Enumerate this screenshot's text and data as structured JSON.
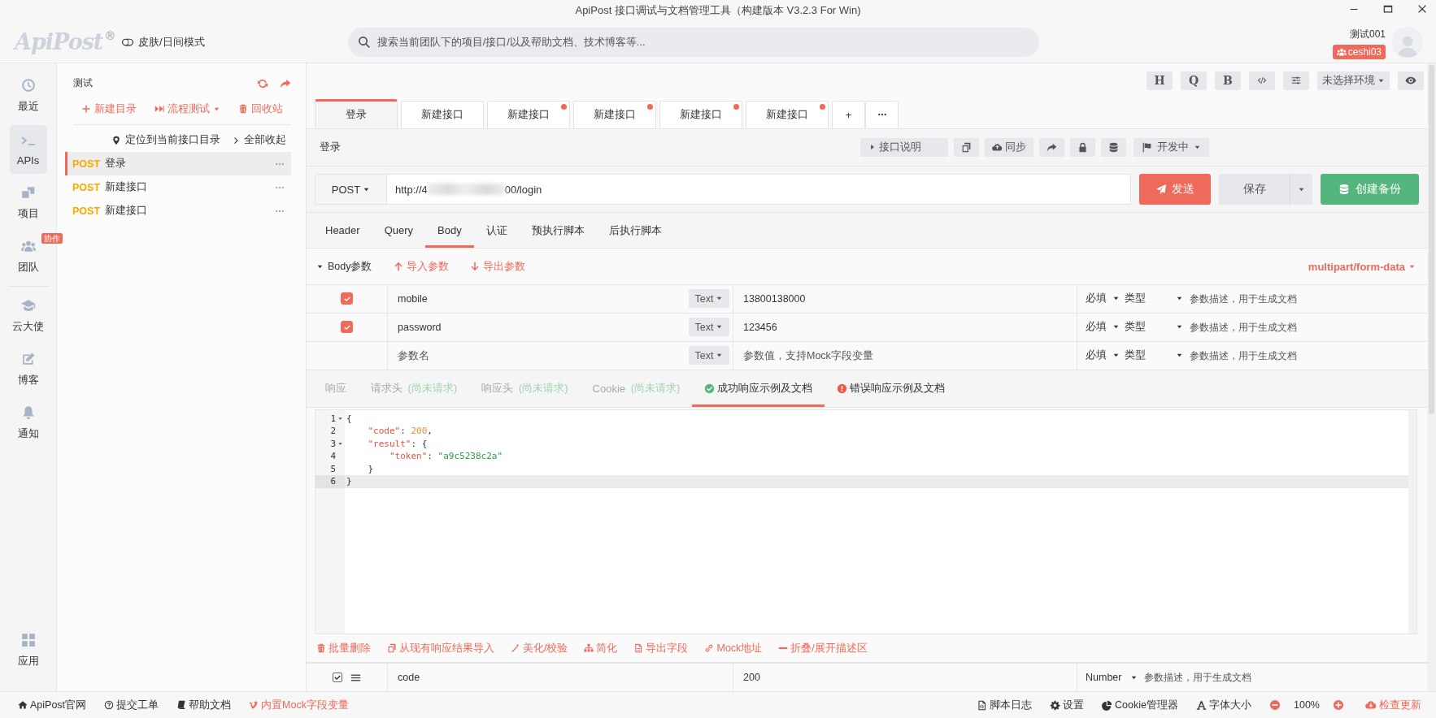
{
  "window": {
    "title": "ApiPost 接口调试与文档管理工具（构建版本 V3.2.3 For Win)"
  },
  "header": {
    "logo": "ApiPost",
    "logo_mark": "®",
    "theme_toggle": "皮肤/日间模式",
    "search": {
      "placeholder": "搜索当前团队下的项目/接口/以及帮助文档、技术博客等..."
    },
    "user_name": "测试001",
    "team": "ceshi03"
  },
  "nav": {
    "items": [
      {
        "label": "最近",
        "selected": false
      },
      {
        "label": "APIs",
        "selected": true
      },
      {
        "label": "项目",
        "selected": false
      },
      {
        "label": "团队",
        "selected": false,
        "badge": "协作"
      },
      {
        "label": "云大使",
        "selected": false
      },
      {
        "label": "博客",
        "selected": false
      },
      {
        "label": "通知",
        "selected": false
      }
    ],
    "bottom": {
      "label": "应用",
      "selected": false
    }
  },
  "tree": {
    "title": "测试",
    "actions": [
      "新建目录",
      "流程测试",
      "回收站"
    ],
    "locate": "定位到当前接口目录",
    "collapse": "全部收起",
    "items": [
      {
        "method": "POST",
        "name": "登录",
        "selected": true
      },
      {
        "method": "POST",
        "name": "新建接口",
        "selected": false
      },
      {
        "method": "POST",
        "name": "新建接口",
        "selected": false
      }
    ]
  },
  "toolbar": {
    "letters": [
      "H",
      "Q",
      "B"
    ],
    "environment": "未选择环境"
  },
  "tabs": [
    {
      "label": "登录",
      "selected": true,
      "modified": false
    },
    {
      "label": "新建接口",
      "selected": false,
      "modified": false
    },
    {
      "label": "新建接口",
      "selected": false,
      "modified": true
    },
    {
      "label": "新建接口",
      "selected": false,
      "modified": true
    },
    {
      "label": "新建接口",
      "selected": false,
      "modified": true
    },
    {
      "label": "新建接口",
      "selected": false,
      "modified": true
    }
  ],
  "new_tab": "+",
  "api": {
    "name": "登录",
    "doc_button": "接口说明",
    "sync_button": "同步",
    "status": "开发中"
  },
  "request": {
    "method": "POST",
    "url_start": "http://4",
    "url_end": "00/login",
    "send": "发送",
    "save": "保存",
    "backup": "创建备份"
  },
  "request_tabs": [
    {
      "label": "Header",
      "selected": false
    },
    {
      "label": "Query",
      "selected": false
    },
    {
      "label": "Body",
      "selected": true
    },
    {
      "label": "认证",
      "selected": false
    },
    {
      "label": "预执行脚本",
      "selected": false
    },
    {
      "label": "后执行脚本",
      "selected": false
    }
  ],
  "body": {
    "title": "Body参数",
    "import": "导入参数",
    "export": "导出参数",
    "content_type": "multipart/form-data",
    "params": [
      {
        "checked": true,
        "key": "mobile",
        "type": "Text",
        "value": "13800138000",
        "required": "必填",
        "data_type": "类型",
        "description_placeholder": "参数描述，用于生成文档"
      },
      {
        "checked": true,
        "key": "password",
        "type": "Text",
        "value": "123456",
        "required": "必填",
        "data_type": "类型",
        "description_placeholder": "参数描述，用于生成文档"
      },
      {
        "key_placeholder": "参数名",
        "type": "Text",
        "value_placeholder": "参数值，支持Mock字段变量",
        "required": "必填",
        "data_type": "类型",
        "description_placeholder": "参数描述，用于生成文档"
      }
    ]
  },
  "response_tabs": [
    {
      "label": "响应",
      "kind": "plain",
      "selected": false
    },
    {
      "label": "请求头",
      "note": "(尚未请求)",
      "kind": "plain",
      "selected": false
    },
    {
      "label": "响应头",
      "note": "(尚未请求)",
      "kind": "plain",
      "selected": false
    },
    {
      "label": "Cookie",
      "note": "(尚未请求)",
      "kind": "plain",
      "selected": false
    },
    {
      "label": "成功响应示例及文档",
      "kind": "success",
      "selected": true
    },
    {
      "label": "错误响应示例及文档",
      "kind": "error",
      "selected": false
    }
  ],
  "editor": {
    "lines": [
      {
        "number": "1",
        "fold": true,
        "selected": false,
        "tokens": [
          {
            "text": "{",
            "kind": "punct"
          }
        ]
      },
      {
        "number": "2",
        "fold": false,
        "selected": false,
        "tokens": [
          {
            "text": "    \"code\"",
            "kind": "key"
          },
          {
            "text": ": ",
            "kind": "punct"
          },
          {
            "text": "200",
            "kind": "number"
          },
          {
            "text": ",",
            "kind": "punct"
          }
        ]
      },
      {
        "number": "3",
        "fold": true,
        "selected": false,
        "tokens": [
          {
            "text": "    \"result\"",
            "kind": "key"
          },
          {
            "text": ": {",
            "kind": "punct"
          }
        ]
      },
      {
        "number": "4",
        "fold": false,
        "selected": false,
        "tokens": [
          {
            "text": "        \"token\"",
            "kind": "key"
          },
          {
            "text": ": ",
            "kind": "punct"
          },
          {
            "text": "\"a9c5238c2a\"",
            "kind": "string"
          }
        ]
      },
      {
        "number": "5",
        "fold": false,
        "selected": false,
        "tokens": [
          {
            "text": "    }",
            "kind": "punct"
          }
        ]
      },
      {
        "number": "6",
        "fold": false,
        "selected": true,
        "tokens": [
          {
            "text": "}",
            "kind": "punct"
          }
        ]
      }
    ]
  },
  "response_tools": [
    "批量删除",
    "从现有响应结果导入",
    "美化/校验",
    "简化",
    "导出字段",
    "Mock地址",
    "折叠/展开描述区"
  ],
  "response_params": [
    {
      "checked": true,
      "key": "code",
      "value": "200",
      "type": "Number",
      "description_placeholder": "参数描述，用于生成文档"
    }
  ],
  "status_bar": {
    "left": [
      "ApiPost官网",
      "提交工单",
      "帮助文档",
      "内置Mock字段变量"
    ],
    "right": [
      "脚本日志",
      "设置",
      "Cookie管理器",
      "字体大小"
    ],
    "zoom": "100%",
    "update": "检查更新"
  }
}
